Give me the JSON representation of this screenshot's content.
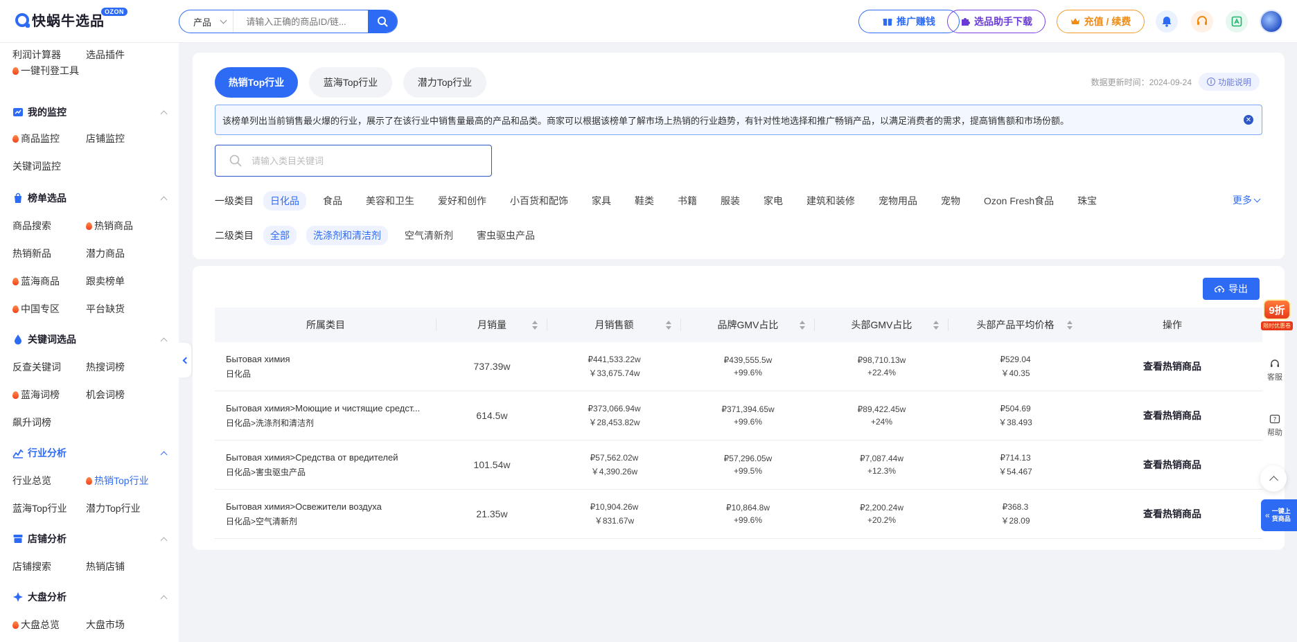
{
  "header": {
    "logo_text": "快蜗牛选品",
    "logo_badge": "OZON",
    "search": {
      "type_value": "产品",
      "placeholder": "请输入正确的商品ID/链..."
    },
    "buttons": {
      "promo": "推广赚钱",
      "helper": "选品助手下载",
      "recharge": "充值 / 续费"
    }
  },
  "sidebar": {
    "top_items": [
      "利润计算器",
      "选品插件",
      "一键刊登工具"
    ],
    "groups": [
      {
        "title": "我的监控",
        "items": [
          "商品监控",
          "店铺监控",
          "关键词监控"
        ]
      },
      {
        "title": "榜单选品",
        "items": [
          "商品搜索",
          "热销商品",
          "热销新品",
          "潜力商品",
          "蓝海商品",
          "跟卖榜单",
          "中国专区",
          "平台缺货"
        ]
      },
      {
        "title": "关键词选品",
        "items": [
          "反查关键词",
          "热搜词榜",
          "蓝海词榜",
          "机会词榜",
          "飙升词榜"
        ]
      },
      {
        "title": "行业分析",
        "items": [
          "行业总览",
          "热销Top行业",
          "蓝海Top行业",
          "潜力Top行业"
        ]
      },
      {
        "title": "店铺分析",
        "items": [
          "店铺搜索",
          "热销店铺"
        ]
      },
      {
        "title": "大盘分析",
        "items": [
          "大盘总览",
          "大盘市场"
        ]
      }
    ]
  },
  "main": {
    "tabs": [
      "热销Top行业",
      "蓝海Top行业",
      "潜力Top行业"
    ],
    "update_time": "数据更新时间：2024-09-24",
    "func_desc": "功能说明",
    "notice": "该榜单列出当前销售最火爆的行业，展示了在该行业中销售量最高的产品和品类。商家可以根据该榜单了解市场上热销的行业趋势，有针对性地选择和推广畅销产品，以满足消费者的需求，提高销售额和市场份额。",
    "category_search_placeholder": "请输入类目关键词",
    "level1_label": "一级类目",
    "level1": [
      "日化品",
      "食品",
      "美容和卫生",
      "爱好和创作",
      "小百货和配饰",
      "家具",
      "鞋类",
      "书籍",
      "服装",
      "家电",
      "建筑和装修",
      "宠物用品",
      "宠物",
      "Ozon Fresh食品",
      "珠宝"
    ],
    "more": "更多",
    "level2_label": "二级类目",
    "level2": [
      "全部",
      "洗涤剂和清洁剂",
      "空气清新剂",
      "害虫驱虫产品"
    ]
  },
  "table": {
    "export": "导出",
    "columns": [
      "所属类目",
      "月销量",
      "月销售额",
      "品牌GMV占比",
      "头部GMV占比",
      "头部产品平均价格",
      "操作"
    ],
    "rows": [
      {
        "cat_ru": "Бытовая химия",
        "cat_cn": "日化品",
        "sales": "737.39w",
        "gmv_rub": "₽441,533.22w",
        "gmv_cny": "￥33,675.74w",
        "brand_gmv": "₽439,555.5w",
        "brand_pct": "+99.6%",
        "head_gmv": "₽98,710.13w",
        "head_pct": "+22.4%",
        "avg_rub": "₽529.04",
        "avg_cny": "￥40.35",
        "op": "查看热销商品"
      },
      {
        "cat_ru": "Бытовая химия>Моющие и чистящие средст...",
        "cat_cn": "日化品>洗涤剂和清洁剂",
        "sales": "614.5w",
        "gmv_rub": "₽373,066.94w",
        "gmv_cny": "￥28,453.82w",
        "brand_gmv": "₽371,394.65w",
        "brand_pct": "+99.6%",
        "head_gmv": "₽89,422.45w",
        "head_pct": "+24%",
        "avg_rub": "₽504.69",
        "avg_cny": "￥38.493",
        "op": "查看热销商品"
      },
      {
        "cat_ru": "Бытовая химия>Средства от вредителей",
        "cat_cn": "日化品>害虫驱虫产品",
        "sales": "101.54w",
        "gmv_rub": "₽57,562.02w",
        "gmv_cny": "￥4,390.26w",
        "brand_gmv": "₽57,296.05w",
        "brand_pct": "+99.5%",
        "head_gmv": "₽7,087.44w",
        "head_pct": "+12.3%",
        "avg_rub": "₽714.13",
        "avg_cny": "￥54.467",
        "op": "查看热销商品"
      },
      {
        "cat_ru": "Бытовая химия>Освежители воздуха",
        "cat_cn": "日化品>空气清新剂",
        "sales": "21.35w",
        "gmv_rub": "₽10,904.26w",
        "gmv_cny": "￥831.67w",
        "brand_gmv": "₽10,864.8w",
        "brand_pct": "+99.6%",
        "head_gmv": "₽2,200.24w",
        "head_pct": "+20.2%",
        "avg_rub": "₽368.3",
        "avg_cny": "￥28.09",
        "op": "查看热销商品"
      }
    ]
  },
  "float": {
    "discount": "9折",
    "discount_sub": "限时优惠卷",
    "service": "客服",
    "help": "帮助",
    "one_click": "一键上货商品"
  }
}
